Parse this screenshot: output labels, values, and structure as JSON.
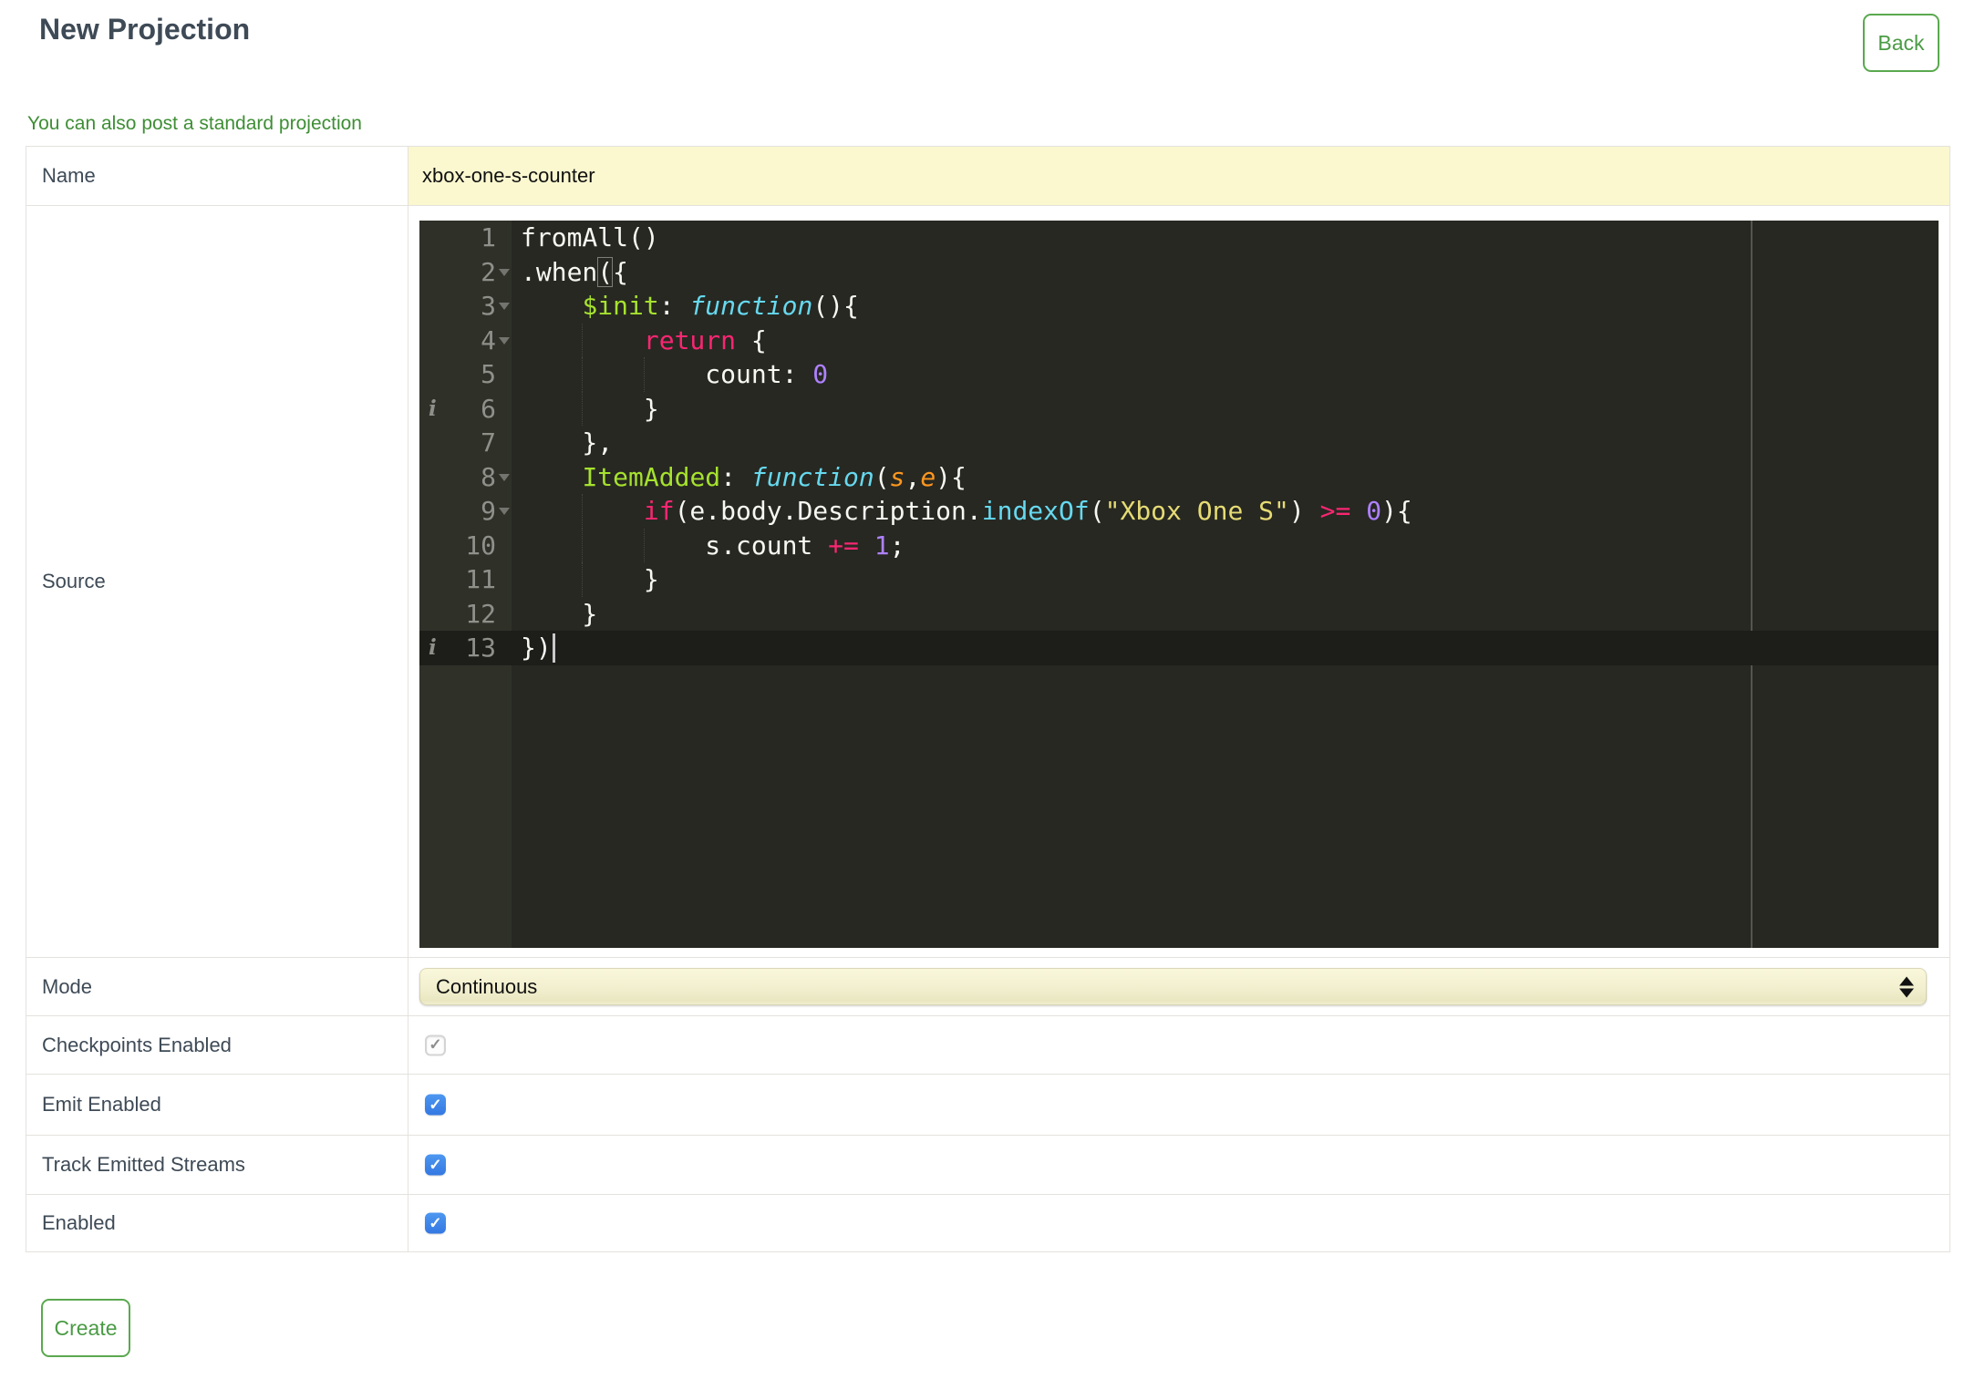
{
  "page": {
    "title": "New Projection",
    "back_button": "Back",
    "link_text": "You can also post a standard projection",
    "create_button": "Create"
  },
  "form": {
    "rows": [
      {
        "label": "Name",
        "type": "text-input",
        "value": "xbox-one-s-counter"
      },
      {
        "label": "Source",
        "type": "code-editor"
      },
      {
        "label": "Mode",
        "type": "select",
        "value": "Continuous"
      },
      {
        "label": "Checkpoints Enabled",
        "type": "checkbox",
        "checked": true,
        "disabled": true
      },
      {
        "label": "Emit Enabled",
        "type": "checkbox",
        "checked": true,
        "disabled": false
      },
      {
        "label": "Track Emitted Streams",
        "type": "checkbox",
        "checked": true,
        "disabled": false
      },
      {
        "label": "Enabled",
        "type": "checkbox",
        "checked": true,
        "disabled": false
      }
    ]
  },
  "editor": {
    "language": "javascript",
    "active_line": 13,
    "cursor": {
      "line": 13,
      "column": 2
    },
    "print_margin_column": 80,
    "annotation_lines": [
      6,
      13
    ],
    "fold_lines": [
      2,
      3,
      4,
      8,
      9
    ],
    "bracket_highlight": {
      "line": 2,
      "token_index": 1
    },
    "colors": {
      "background": "#272822",
      "gutter_background": "#2f3129",
      "gutter_text": "#8f908a",
      "active_line": "#1d1e19",
      "plain": "#f8f8f2",
      "keyword": "#f92672",
      "property": "#a6e22e",
      "function_keyword": "#66d9ef",
      "support_function": "#66d9ef",
      "parameter": "#fd971f",
      "number": "#ae81ff",
      "string": "#e6db74"
    },
    "lines": [
      [
        [
          "p",
          "fromAll()"
        ]
      ],
      [
        [
          "p",
          ".when"
        ],
        [
          "pb",
          "("
        ],
        [
          "p",
          "{"
        ]
      ],
      [
        [
          "p",
          "    "
        ],
        [
          "prop",
          "$init"
        ],
        [
          "p",
          ": "
        ],
        [
          "fn",
          "function"
        ],
        [
          "p",
          "(){"
        ]
      ],
      [
        [
          "p",
          "        "
        ],
        [
          "kw",
          "return"
        ],
        [
          "p",
          " {"
        ]
      ],
      [
        [
          "p",
          "            count: "
        ],
        [
          "num",
          "0"
        ]
      ],
      [
        [
          "p",
          "        }"
        ]
      ],
      [
        [
          "p",
          "    },"
        ]
      ],
      [
        [
          "p",
          "    "
        ],
        [
          "prop",
          "ItemAdded"
        ],
        [
          "p",
          ": "
        ],
        [
          "fn",
          "function"
        ],
        [
          "p",
          "("
        ],
        [
          "par",
          "s"
        ],
        [
          "p",
          ","
        ],
        [
          "par",
          "e"
        ],
        [
          "p",
          "){"
        ]
      ],
      [
        [
          "p",
          "        "
        ],
        [
          "kw",
          "if"
        ],
        [
          "p",
          "(e.body.Description."
        ],
        [
          "sup",
          "indexOf"
        ],
        [
          "p",
          "("
        ],
        [
          "str",
          "\"Xbox One S\""
        ],
        [
          "p",
          ") "
        ],
        [
          "kw",
          ">="
        ],
        [
          "p",
          " "
        ],
        [
          "num",
          "0"
        ],
        [
          "p",
          "){"
        ]
      ],
      [
        [
          "p",
          "            s.count "
        ],
        [
          "kw",
          "+="
        ],
        [
          "p",
          " "
        ],
        [
          "num",
          "1"
        ],
        [
          "p",
          ";"
        ]
      ],
      [
        [
          "p",
          "        }"
        ]
      ],
      [
        [
          "p",
          "    }"
        ]
      ],
      [
        [
          "p",
          "})"
        ]
      ]
    ]
  },
  "ui_colors": {
    "accent_green": "#4a9b44",
    "link_green": "#3e8e35",
    "field_yellow": "#fbf8d0",
    "checkbox_blue": "#3d85e6",
    "label_text": "#3e4a56",
    "table_border": "#e4e2de"
  }
}
